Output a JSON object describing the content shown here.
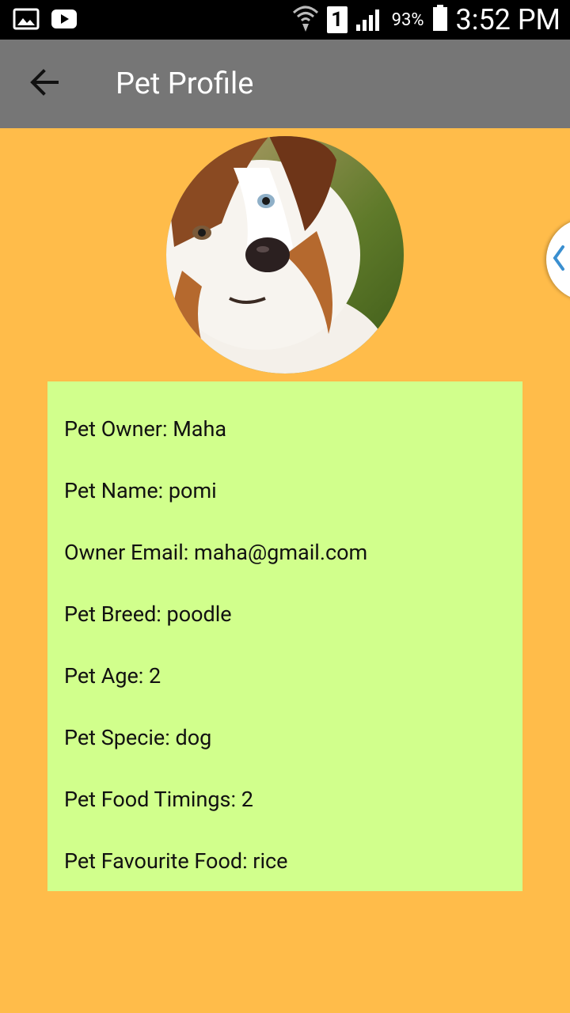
{
  "status_bar": {
    "battery_percent": "93%",
    "time": "3:52 PM",
    "sim_slot": "1",
    "icons": [
      "image-icon",
      "youtube-icon",
      "wifi-icon",
      "sim-icon",
      "signal-icon",
      "battery-icon"
    ]
  },
  "toolbar": {
    "title": "Pet Profile",
    "back_icon": "arrow-back-icon"
  },
  "profile": {
    "avatar": "dog-photo",
    "fields": [
      {
        "label": "Pet Owner: Maha"
      },
      {
        "label": "Pet Name: pomi"
      },
      {
        "label": "Owner Email: maha@gmail.com"
      },
      {
        "label": "Pet Breed: poodle"
      },
      {
        "label": "Pet Age: 2"
      },
      {
        "label": "Pet Specie: dog"
      },
      {
        "label": "Pet Food Timings: 2"
      },
      {
        "label": "Pet Favourite Food: rice"
      }
    ]
  },
  "colors": {
    "background": "#FFBC4A",
    "toolbar": "#767676",
    "card": "#D1FF8C"
  }
}
